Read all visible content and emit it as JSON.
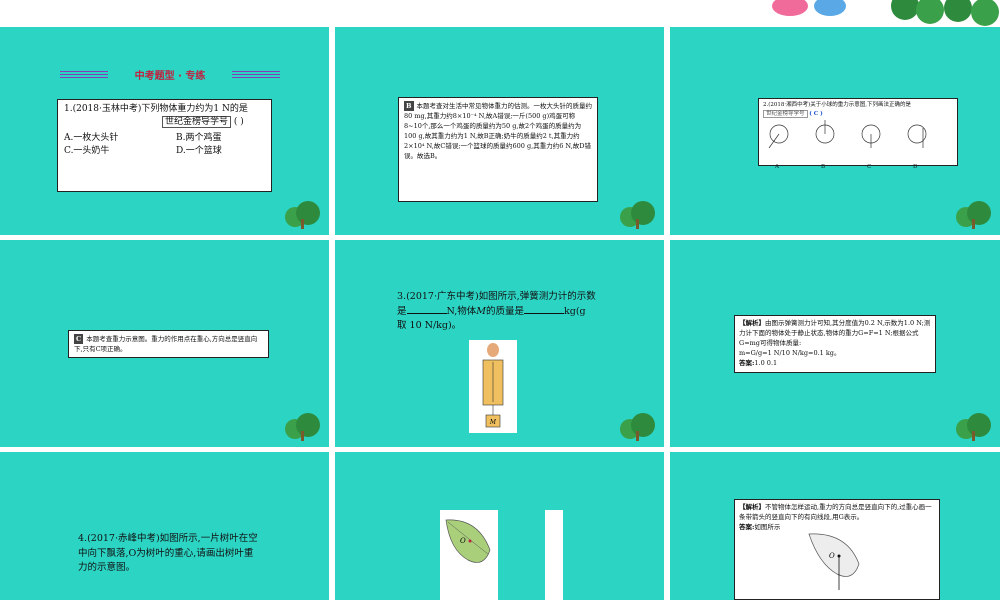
{
  "slide1": {
    "heading": "中考题型 · 专练",
    "question": "1.(2018·玉林中考)下列物体重力约为1 N的是",
    "brand_tag": "世纪金榜导学号",
    "paren": "(        )",
    "options": [
      "A.一枚大头针",
      "B.两个鸡蛋",
      "C.一头奶牛",
      "D.一个篮球"
    ]
  },
  "slide2": {
    "answer_letter": "B",
    "explanation": "本题考查对生活中常见物体重力的估测。一枚大头针的质量约80 mg,其重力约8×10⁻⁴ N,故A错误;一斤(500 g)鸡蛋可称8~10个,那么一个鸡蛋的质量约为50 g,故2个鸡蛋的质量约为100 g,故其重力约为1 N,故B正确;奶牛的质量约2 t,其重力约2×10⁴ N,故C错误;一个篮球的质量约600 g,其重力约6 N,故D错误。故选B。"
  },
  "slide3": {
    "question": "2.(2018·湘西中考)关于小球的重力示意图,下列画法正确的是",
    "brand_tag": "世纪金榜导学号",
    "answer": "( C )",
    "labels": [
      "A",
      "B",
      "C",
      "D"
    ],
    "g_label": "G"
  },
  "slide4": {
    "answer_letter": "C",
    "explanation": "本题考查重力示意图。重力的作用点在重心,方向总是竖直向下,只有C项正确。"
  },
  "slide5": {
    "question_part1": "3.(2017·广东中考)如图所示,弹簧测力计的示数是",
    "question_part2": "N,物体",
    "question_part3": "M",
    "question_part4": "的质量是",
    "question_part5": "kg(g 取 10 N/kg)。",
    "m_label": "M"
  },
  "slide6": {
    "tag": "【解析】",
    "text": "由图示弹簧测力计可知,其分度值为0.2 N,示数为1.0 N;测力计下面的物体处于静止状态,物体的重力G=F=1 N;根据公式G=mg可得物体质量:",
    "formula": "m=G/g=1 N/10 N/kg=0.1 kg。",
    "answer_label": "答案:",
    "answer_value": "1.0   0.1"
  },
  "slide7": {
    "question": "4.(2017·赤峰中考)如图所示,一片树叶在空中向下飘落,O为树叶的重心,请画出树叶重力的示意图。"
  },
  "slide8": {
    "o_label": "O"
  },
  "slide9": {
    "tag": "【解析】",
    "text": "不管物体怎样运动,重力的方向总是竖直向下的,过重心画一条带箭头的竖直向下的有向线段,用G表示。",
    "answer_label": "答案:",
    "answer_value": "如图所示",
    "o_label": "O"
  },
  "colors": {
    "slide_bg": "#2cd4c4",
    "heading": "#c0223f",
    "leaf": "#a9cf7a"
  }
}
